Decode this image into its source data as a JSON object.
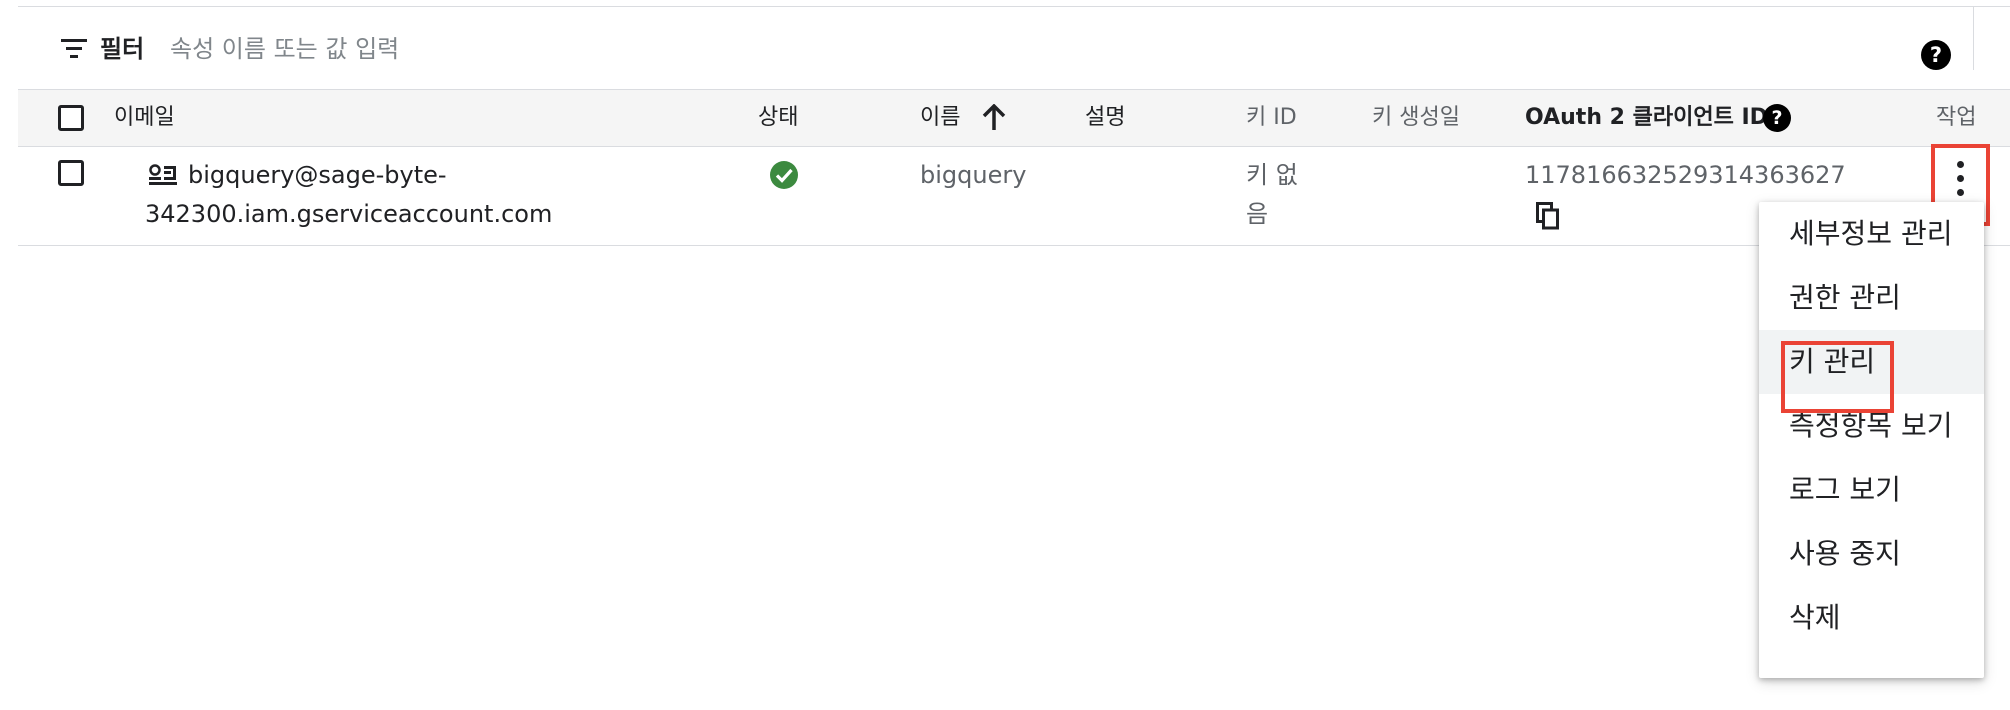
{
  "filter": {
    "label": "필터",
    "placeholder": "속성 이름 또는 값 입력"
  },
  "table": {
    "columns": {
      "email": "이메일",
      "status": "상태",
      "name": "이름",
      "description": "설명",
      "key_id": "키 ID",
      "key_created": "키 생성일",
      "oauth_client_id": "OAuth 2 클라이언트 ID",
      "actions": "작업"
    },
    "sort": {
      "column": "이름",
      "direction": "ascending"
    },
    "rows": [
      {
        "email_line1": "bigquery@sage-byte-",
        "email_line2": "342300.iam.gserviceaccount.com",
        "status": "enabled",
        "name": "bigquery",
        "description": "",
        "key_id_line1": "키 없",
        "key_id_line2": "음",
        "key_created": "",
        "oauth_client_id": "117816632529314363627"
      }
    ]
  },
  "action_menu": {
    "items": [
      {
        "label": "세부정보 관리"
      },
      {
        "label": "권한 관리"
      },
      {
        "label": "키 관리"
      },
      {
        "label": "측정항목 보기"
      },
      {
        "label": "로그 보기"
      },
      {
        "label": "사용 중지"
      },
      {
        "label": "삭제"
      }
    ],
    "hovered_item": "키 관리"
  },
  "colors": {
    "status_ok": "#34a853",
    "highlight": "#ea4335",
    "header_bg": "#f5f5f5"
  },
  "icons": {
    "filter": "filter-list-icon",
    "help": "help-icon",
    "sort": "arrow-upward-icon",
    "service_account": "service-account-icon",
    "status": "check-circle-icon",
    "copy": "copy-icon",
    "more": "more-vert-icon"
  }
}
